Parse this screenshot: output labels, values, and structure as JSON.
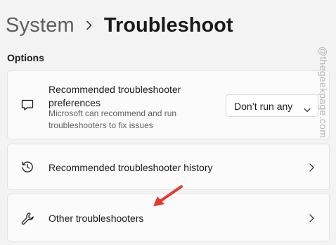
{
  "breadcrumb": {
    "parent": "System",
    "current": "Troubleshoot"
  },
  "section": {
    "label": "Options"
  },
  "items": [
    {
      "icon": "chat-bubble-icon",
      "title": "Recommended troubleshooter preferences",
      "description": "Microsoft can recommend and run troubleshooters to fix issues",
      "control": {
        "type": "dropdown",
        "value": "Don’t run any"
      }
    },
    {
      "icon": "history-icon",
      "title": "Recommended troubleshooter history",
      "control": {
        "type": "chevron"
      }
    },
    {
      "icon": "wrench-icon",
      "title": "Other troubleshooters",
      "control": {
        "type": "chevron"
      }
    }
  ],
  "watermark": {
    "text": "@thegeekpage.com"
  },
  "colors": {
    "background": "#f3f3f3",
    "card": "#fbfbfb",
    "annotation_arrow": "#e53935"
  }
}
